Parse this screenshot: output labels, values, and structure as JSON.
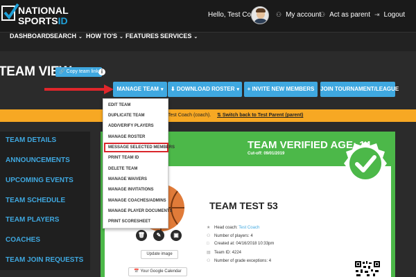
{
  "header": {
    "logo_line1": "NATIONAL",
    "logo_line2_a": "SPORTS",
    "logo_line2_b": "ID",
    "greeting": "Hello, Test Coach",
    "my_account": "My account",
    "act_as_parent": "Act as parent",
    "logout": "Logout"
  },
  "nav": {
    "dashboard": "DASHBOARD",
    "search": "SEARCH",
    "howtos": "HOW TO'S",
    "features": "FEATURES",
    "services": "SERVICES"
  },
  "page": {
    "title": "TEAM VIEW",
    "copy_link": "Copy team link"
  },
  "actions": {
    "manage_team": "MANAGE TEAM",
    "download_roster": "DOWNLOAD ROSTER",
    "invite_members": "+ INVITE NEW MEMBERS",
    "join_tournament": "JOIN TOURNAMENT/LEAGUE"
  },
  "notice": {
    "text": "Test Coach (coach).",
    "link": "Switch back to Test Parent (parent)"
  },
  "dropdown": [
    "EDIT TEAM",
    "DUPLICATE TEAM",
    "ADD/VERIFY PLAYERS",
    "MANAGE ROSTER",
    "MESSAGE SELECTED MEMBERS",
    "PRINT TEAM ID",
    "DELETE TEAM",
    "MANAGE WAIVERS",
    "MANAGE INVITATIONS",
    "MANAGE COACHES/ADMINS",
    "MANAGE PLAYER DOCUMENTS",
    "PRINT SCORESHEET"
  ],
  "sidebar": [
    "TEAM DETAILS",
    "ANNOUNCEMENTS",
    "UPCOMING EVENTS",
    "TEAM SCHEDULE",
    "TEAM PLAYERS",
    "COACHES",
    "TEAM JOIN REQUESTS"
  ],
  "team": {
    "verified_age": "TEAM VERIFIED AGE: 14",
    "cutoff": "Cut-off: 09/01/2019",
    "name": "TEAM TEST 53",
    "head_coach_label": "Head coach:",
    "head_coach": "Test Coach",
    "players": "Number of players: 4",
    "created": "Created at: 04/16/2018 10:33pm",
    "team_id": "Team ID: 4224",
    "grade_exceptions": "Number of grade exceptions: 4",
    "update_image": "Update image",
    "google_calendar": "Your Google Calendar"
  },
  "colors": {
    "accent": "#3fa8e0",
    "green": "#4cb849",
    "orange": "#f7a823",
    "highlight": "#d9252a"
  }
}
